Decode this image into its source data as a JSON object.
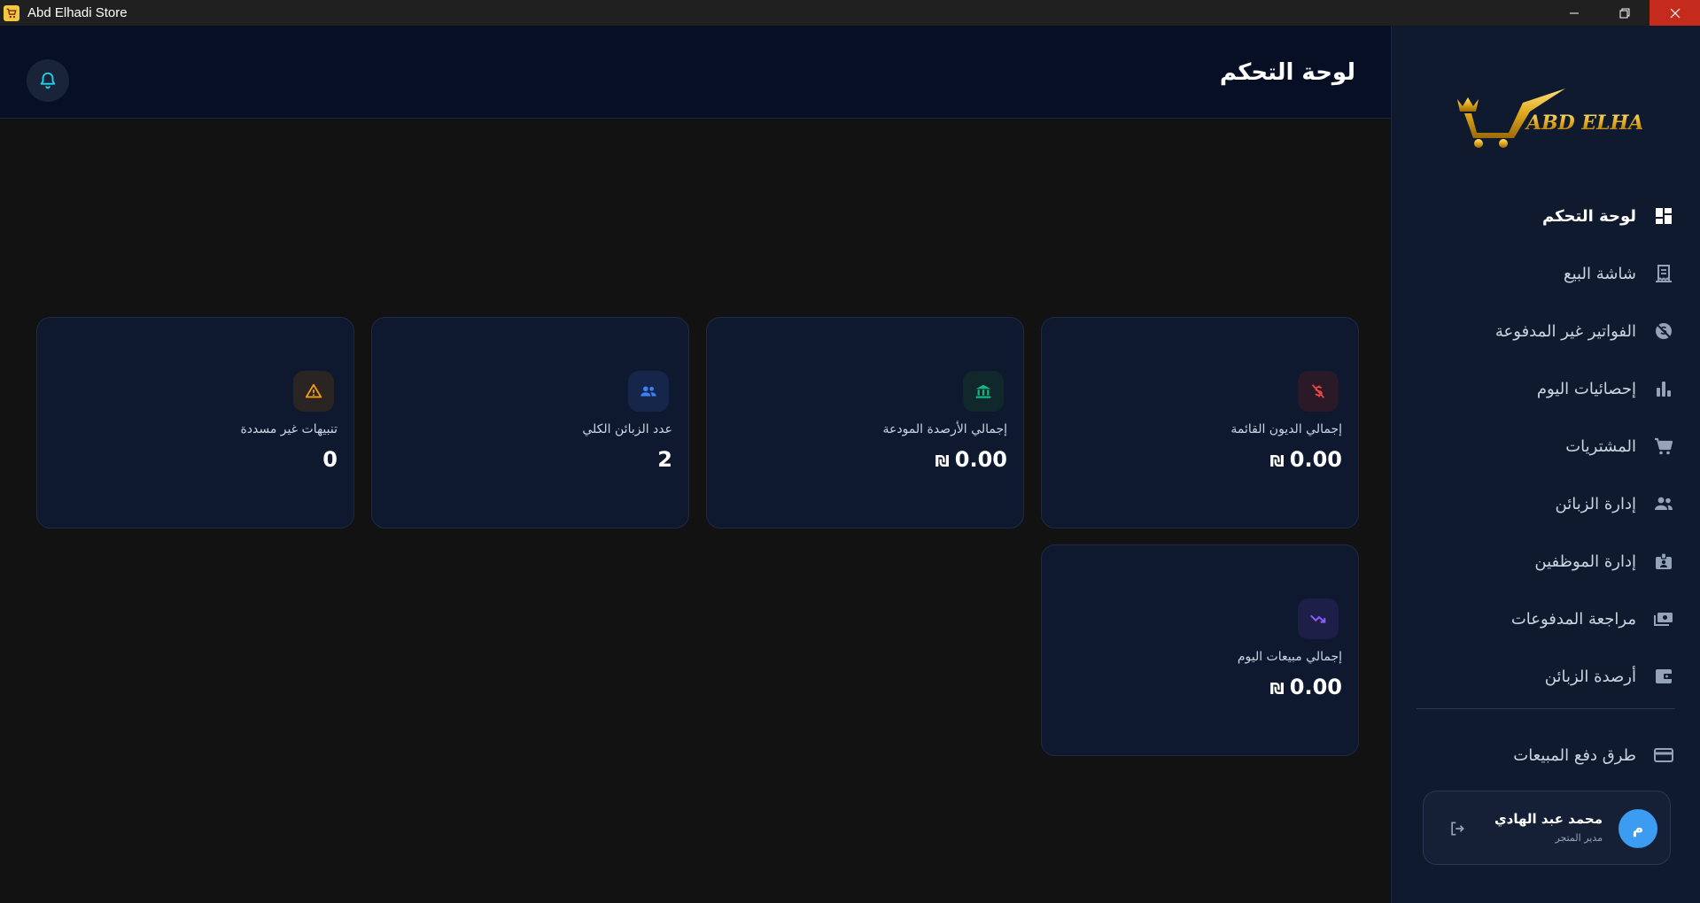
{
  "window": {
    "title": "Abd Elhadi Store",
    "controls": [
      "minimize",
      "restore",
      "close"
    ]
  },
  "header": {
    "title": "لوحة التحكم",
    "notification_icon": "bell-icon"
  },
  "cards": [
    {
      "label": "إجمالي الديون القائمة",
      "value": "0.00",
      "currency": "₪",
      "icon": "money-off-icon",
      "accent": "#ef4444"
    },
    {
      "label": "إجمالي الأرصدة المودعة",
      "value": "0.00",
      "currency": "₪",
      "icon": "bank-icon",
      "accent": "#10b981"
    },
    {
      "label": "عدد الزبائن الكلي",
      "value": "2",
      "currency": "",
      "icon": "users-icon",
      "accent": "#3b82f6"
    },
    {
      "label": "تنبيهات غير مسددة",
      "value": "0",
      "currency": "",
      "icon": "warning-icon",
      "accent": "#f59e0b"
    },
    {
      "label": "إجمالي مبيعات اليوم",
      "value": "0.00",
      "currency": "₪",
      "icon": "trend-icon",
      "accent": "#8b5cf6"
    }
  ],
  "sidebar": {
    "logo_text": "ABD ELHADI",
    "items": [
      {
        "label": "لوحة التحكم",
        "icon": "dashboard-icon",
        "active": true
      },
      {
        "label": "شاشة البيع",
        "icon": "receipt-icon",
        "active": false
      },
      {
        "label": "الفواتير غير المدفوعة",
        "icon": "no-payment-icon",
        "active": false
      },
      {
        "label": "إحصائيات اليوم",
        "icon": "bar-chart-icon",
        "active": false
      },
      {
        "label": "المشتريات",
        "icon": "cart-icon",
        "active": false
      },
      {
        "label": "إدارة الزبائن",
        "icon": "people-icon",
        "active": false
      },
      {
        "label": "إدارة الموظفين",
        "icon": "badge-icon",
        "active": false
      },
      {
        "label": "مراجعة المدفوعات",
        "icon": "payments-icon",
        "active": false
      },
      {
        "label": "أرصدة الزبائن",
        "icon": "wallet-icon",
        "active": false
      }
    ],
    "bottom_item": {
      "label": "طرق دفع المبيعات",
      "icon": "credit-card-icon"
    },
    "user": {
      "initial": "م",
      "name": "محمد عبد الهادي",
      "role": "مدير المتجر"
    }
  }
}
